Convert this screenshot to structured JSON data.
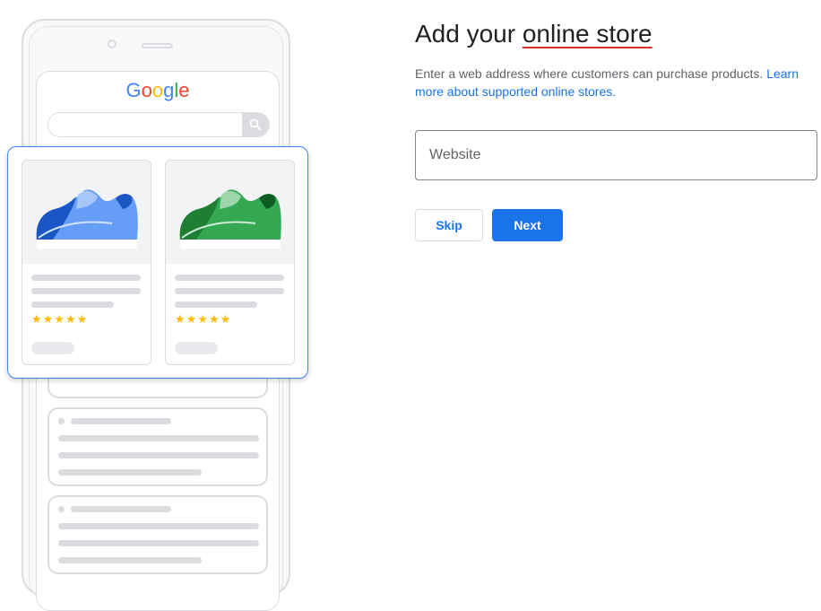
{
  "illustration": {
    "logo_letters": [
      {
        "char": "G",
        "color": "#4285f4"
      },
      {
        "char": "o",
        "color": "#ea4335"
      },
      {
        "char": "o",
        "color": "#fbbc05"
      },
      {
        "char": "g",
        "color": "#4285f4"
      },
      {
        "char": "l",
        "color": "#34a853"
      },
      {
        "char": "e",
        "color": "#ea4335"
      }
    ],
    "search_icon": "search-icon",
    "products": [
      {
        "shoe_color": "#4285f4",
        "shoe_dark": "#1a56c4",
        "rating_stars": "★★★★★"
      },
      {
        "shoe_color": "#34a853",
        "shoe_dark": "#1e7e34",
        "rating_stars": "★★★★★"
      }
    ],
    "star_color": "#fbbc04"
  },
  "form": {
    "title_prefix": "Add your ",
    "title_highlight": "online store",
    "description_text": "Enter a web address where customers can purchase products. ",
    "description_link": "Learn more about supported online stores.",
    "website_value": "",
    "website_placeholder": "Website",
    "skip_label": "Skip",
    "next_label": "Next"
  },
  "colors": {
    "accent": "#1a73e8",
    "underline_red": "#d93025"
  }
}
